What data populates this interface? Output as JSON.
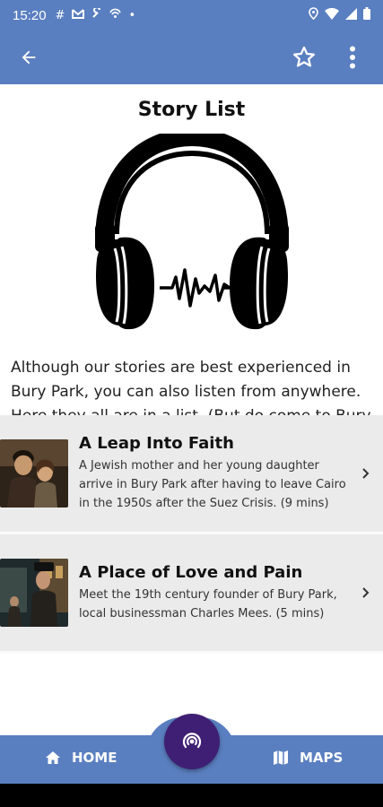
{
  "status_bar": {
    "time": "15:20",
    "notification_icons": [
      "hash-icon",
      "gmail-icon",
      "wrench-icon",
      "vpn-icon",
      "dot-icon"
    ],
    "system_icons": [
      "location-icon",
      "wifi-icon",
      "signal-icon",
      "battery-icon"
    ]
  },
  "app_bar": {
    "back_icon": "arrow-left-icon",
    "favorite_icon": "star-outline-icon",
    "menu_icon": "more-vert-icon"
  },
  "page": {
    "title": "Story List",
    "hero_icon": "headphones-icon",
    "intro": "Although our stories are best experienced in Bury Park, you can also listen from anywhere. Here they all are in a list. (But do come to Bury Park when you can!)"
  },
  "stories": [
    {
      "title": "A Leap Into Faith",
      "description": "A Jewish mother and her young daughter arrive in Bury Park after having to leave Cairo in the 1950s after the Suez Crisis. (9 mins)"
    },
    {
      "title": "A Place of Love and Pain",
      "description": "Meet the 19th century founder of Bury Park, local businessman Charles Mees. (5 mins)"
    }
  ],
  "bottom_nav": {
    "home_label": "HOME",
    "maps_label": "MAPS",
    "fab_icon": "podcast-icon"
  },
  "colors": {
    "primary": "#5a7fc0",
    "fab": "#3e1f73",
    "list_bg": "#ebebeb"
  }
}
